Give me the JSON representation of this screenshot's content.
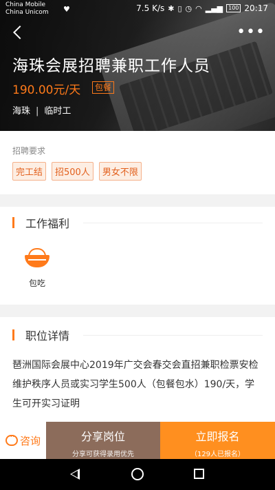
{
  "status_bar": {
    "carrier_1": "China Mobile",
    "carrier_2": "China Unicom",
    "speed": "7.5 K/s",
    "battery": "100",
    "time": "20:17"
  },
  "job": {
    "title": "海珠会展招聘兼职工作人员",
    "salary": "190.00元/天",
    "meal_badge": "包餐",
    "district": "海珠",
    "separator": "|",
    "job_type": "临时工"
  },
  "requirements": {
    "label": "招聘要求",
    "tags": [
      "完工结",
      "招500人",
      "男女不限"
    ]
  },
  "benefits": {
    "title": "工作福利",
    "items": [
      {
        "icon": "bowl-icon",
        "label": "包吃"
      }
    ]
  },
  "details": {
    "title": "职位详情",
    "text": "琶洲国际会展中心2019年广交会春交会直招兼职检票安检维护秩序人员或实习学生500人（包餐包水）190/天，学生可开实习证明"
  },
  "actions": {
    "consult_label": "咨询",
    "share_label": "分享岗位",
    "share_sub": "分享可获得录用优先",
    "apply_label": "立即报名",
    "apply_sub": "（129人已报名）"
  },
  "colors": {
    "accent": "#ff7a1a",
    "share_bg": "#8c6c5b",
    "apply_bg": "#ff8f1f"
  }
}
